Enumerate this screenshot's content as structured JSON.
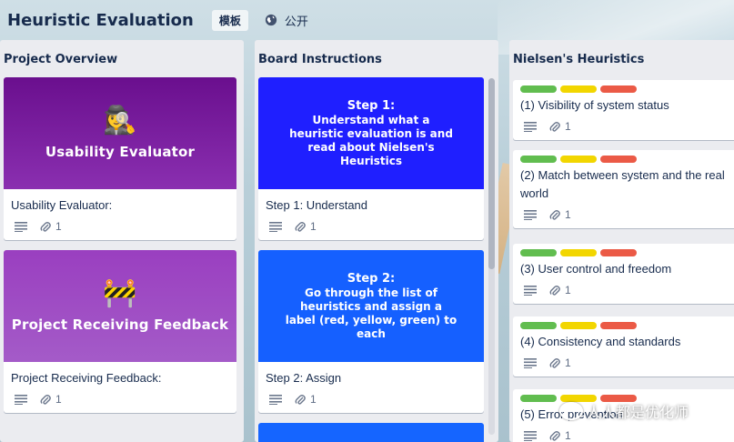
{
  "header": {
    "title": "Heuristic Evaluation",
    "template_badge": "模板",
    "visibility": "公开",
    "visibility_icon": "globe-icon"
  },
  "lists": [
    {
      "name": "Project Overview",
      "cards": [
        {
          "cover_emoji": "🕵️‍♀️",
          "cover_text": "Usability Evaluator",
          "cover_color": "#7b1fa2",
          "title": "Usability Evaluator:",
          "attachments": "1"
        },
        {
          "cover_emoji": "🚧",
          "cover_text": "Project Receiving Feedback",
          "cover_color": "#9c4dcc",
          "title": "Project Receiving Feedback:",
          "attachments": "1"
        }
      ]
    },
    {
      "name": "Board Instructions",
      "cards": [
        {
          "cover_step": "Step 1:",
          "cover_text": "Understand what a heuristic evaluation is and read about Nielsen's Heuristics",
          "cover_color": "#1a1aff",
          "title": "Step 1: Understand",
          "attachments": "1"
        },
        {
          "cover_step": "Step 2:",
          "cover_text": "Go through the list of heuristics and assign a label (red, yellow, green) to each",
          "cover_color": "#1560ff",
          "title": "Step 2: Assign",
          "attachments": "1"
        }
      ]
    },
    {
      "name": "Nielsen's Heuristics",
      "label_colors": [
        "#61bd4f",
        "#f2d600",
        "#eb5a46"
      ],
      "cards": [
        {
          "title": "(1) Visibility of system status",
          "attachments": "1"
        },
        {
          "title": "(2) Match between system and the real world",
          "attachments": "1"
        },
        {
          "title": "(3) User control and freedom",
          "attachments": "1"
        },
        {
          "title": "(4) Consistency and standards",
          "attachments": "1"
        },
        {
          "title": "(5) Error prevention",
          "attachments": "1"
        }
      ]
    }
  ],
  "watermark": "人人都是优化师"
}
